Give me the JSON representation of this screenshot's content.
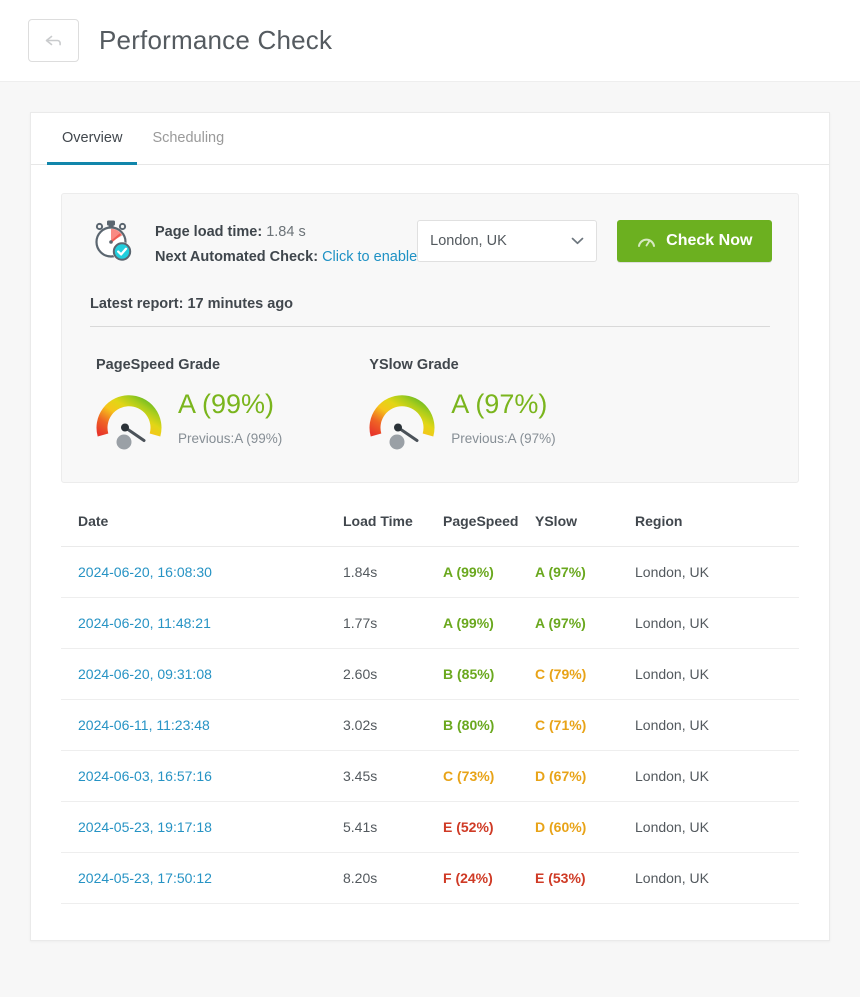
{
  "header": {
    "back_icon": "back-arrow-icon",
    "title": "Performance Check"
  },
  "tabs": [
    {
      "label": "Overview",
      "active": true
    },
    {
      "label": "Scheduling",
      "active": false
    }
  ],
  "summary": {
    "stopwatch_icon": "stopwatch-check-icon",
    "load_time_label": "Page load time:",
    "load_time_value": "1.84 s",
    "next_check_label": "Next Automated Check:",
    "next_check_link": "Click to enable",
    "region_value": "London, UK",
    "region_caret_icon": "chevron-down-icon",
    "check_button_icon": "gauge-icon",
    "check_button_label": "Check Now",
    "latest_report": "Latest report: 17 minutes ago"
  },
  "gauges": [
    {
      "title": "PageSpeed Grade",
      "grade": "A (99%)",
      "previous": "Previous:A (99%)",
      "percent": 99,
      "color": "#7ab51d"
    },
    {
      "title": "YSlow Grade",
      "grade": "A (97%)",
      "previous": "Previous:A (97%)",
      "percent": 97,
      "color": "#7ab51d"
    }
  ],
  "table": {
    "columns": [
      "Date",
      "Load Time",
      "PageSpeed",
      "YSlow",
      "Region"
    ],
    "rows": [
      {
        "date": "2024-06-20, 16:08:30",
        "load": "1.84s",
        "pagespeed": "A (99%)",
        "ps_grade": "a",
        "yslow": "A (97%)",
        "ys_grade": "a",
        "region": "London, UK"
      },
      {
        "date": "2024-06-20, 11:48:21",
        "load": "1.77s",
        "pagespeed": "A (99%)",
        "ps_grade": "a",
        "yslow": "A (97%)",
        "ys_grade": "a",
        "region": "London, UK"
      },
      {
        "date": "2024-06-20, 09:31:08",
        "load": "2.60s",
        "pagespeed": "B (85%)",
        "ps_grade": "b",
        "yslow": "C (79%)",
        "ys_grade": "c",
        "region": "London, UK"
      },
      {
        "date": "2024-06-11, 11:23:48",
        "load": "3.02s",
        "pagespeed": "B (80%)",
        "ps_grade": "b",
        "yslow": "C (71%)",
        "ys_grade": "c",
        "region": "London, UK"
      },
      {
        "date": "2024-06-03, 16:57:16",
        "load": "3.45s",
        "pagespeed": "C (73%)",
        "ps_grade": "c",
        "yslow": "D (67%)",
        "ys_grade": "d",
        "region": "London, UK"
      },
      {
        "date": "2024-05-23, 19:17:18",
        "load": "5.41s",
        "pagespeed": "E (52%)",
        "ps_grade": "e",
        "yslow": "D (60%)",
        "ys_grade": "d",
        "region": "London, UK"
      },
      {
        "date": "2024-05-23, 17:50:12",
        "load": "8.20s",
        "pagespeed": "F (24%)",
        "ps_grade": "f",
        "yslow": "E (53%)",
        "ys_grade": "e",
        "region": "London, UK"
      }
    ]
  },
  "colors": {
    "accent_tab": "#1186ab",
    "link": "#2693c4",
    "button_green": "#6cb020",
    "grade_good": "#6aa81e",
    "grade_mid": "#e8a317",
    "grade_bad": "#cf3a25"
  }
}
